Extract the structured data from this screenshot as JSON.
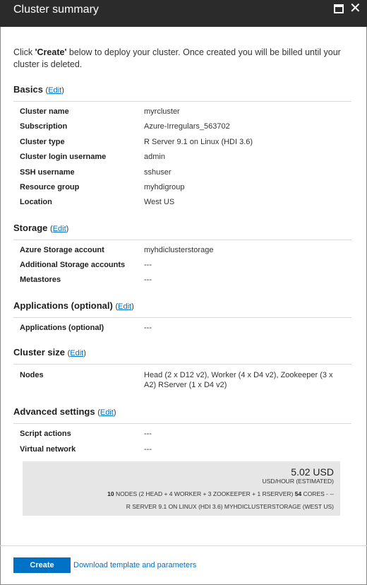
{
  "window": {
    "title": "Cluster summary",
    "maximize_icon": "maximize-icon",
    "close_icon": "close-icon",
    "close_glyph": "✕"
  },
  "intro": {
    "prefix": "Click ",
    "button_name": "'Create'",
    "suffix": " below to deploy your cluster. Once created you will be billed until your cluster is deleted."
  },
  "edit_label": "Edit",
  "sections": {
    "basics": {
      "title": "Basics",
      "rows": [
        {
          "label": "Cluster name",
          "value": "myrcluster"
        },
        {
          "label": "Subscription",
          "value": "Azure-Irregulars_563702"
        },
        {
          "label": "Cluster type",
          "value": "R Server 9.1 on Linux (HDI 3.6)"
        },
        {
          "label": "Cluster login username",
          "value": "admin"
        },
        {
          "label": "SSH username",
          "value": "sshuser"
        },
        {
          "label": "Resource group",
          "value": "myhdigroup"
        },
        {
          "label": "Location",
          "value": "West US"
        }
      ]
    },
    "storage": {
      "title": "Storage",
      "rows": [
        {
          "label": "Azure Storage account",
          "value": "myhdiclusterstorage"
        },
        {
          "label": "Additional Storage accounts",
          "value": "---"
        },
        {
          "label": "Metastores",
          "value": "---"
        }
      ]
    },
    "applications": {
      "title": "Applications (optional)",
      "rows": [
        {
          "label": "Applications (optional)",
          "value": "---"
        }
      ]
    },
    "cluster_size": {
      "title": "Cluster size",
      "rows": [
        {
          "label": "Nodes",
          "value": "Head (2 x D12 v2), Worker (4 x D4 v2), Zookeeper (3 x A2) RServer (1 x D4 v2)"
        }
      ]
    },
    "advanced": {
      "title": "Advanced settings",
      "rows": [
        {
          "label": "Script actions",
          "value": "---"
        },
        {
          "label": "Virtual network",
          "value": "---"
        }
      ]
    }
  },
  "cost": {
    "price": "5.02 USD",
    "unit": "USD/HOUR (ESTIMATED)",
    "node_count": "10",
    "nodes_detail": " NODES (2 HEAD + 4 WORKER + 3 ZOOKEEPER + 1 RSERVER) ",
    "core_count": "54",
    "cores_suffix": " CORES - --",
    "config": "R SERVER 9.1 ON LINUX (HDI 3.6) MYHDICLUSTERSTORAGE (WEST US)"
  },
  "footer": {
    "create_label": "Create",
    "download_label": "Download template and parameters"
  }
}
